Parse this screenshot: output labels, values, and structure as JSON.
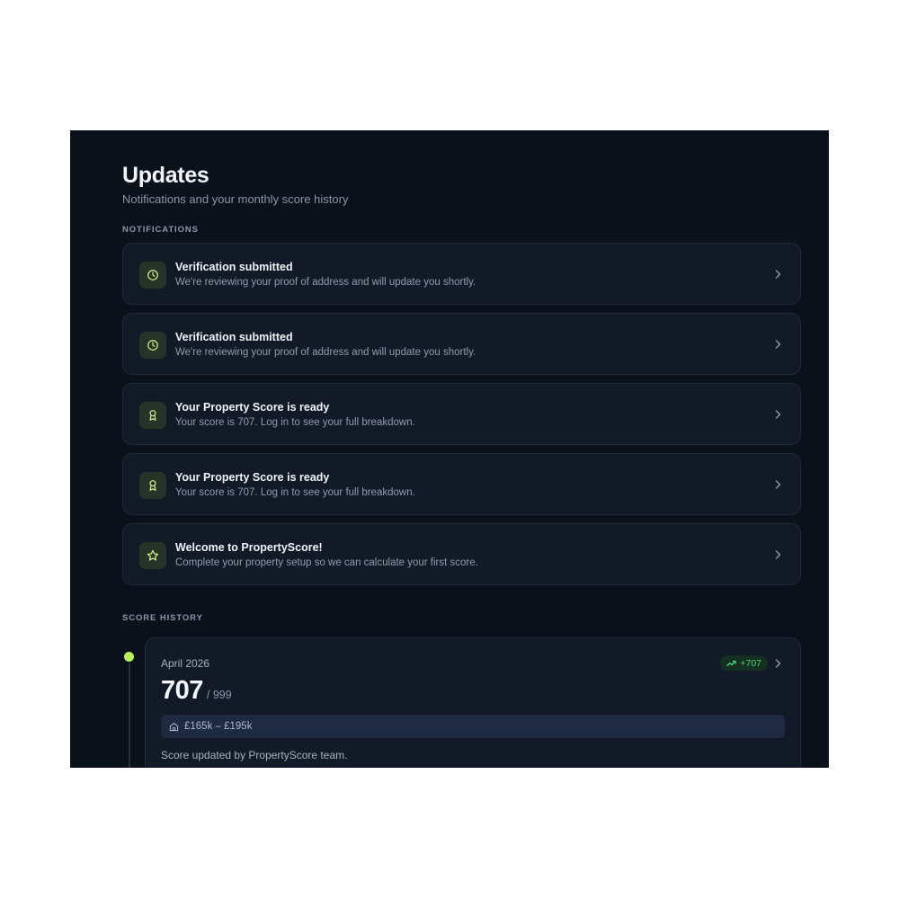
{
  "header": {
    "title": "Updates",
    "subtitle": "Notifications and your monthly score history"
  },
  "notifications": {
    "section_label": "NOTIFICATIONS",
    "items": [
      {
        "icon": "clock-icon",
        "title": "Verification submitted",
        "body": "We're reviewing your proof of address and will update you shortly."
      },
      {
        "icon": "clock-icon",
        "title": "Verification submitted",
        "body": "We're reviewing your proof of address and will update you shortly."
      },
      {
        "icon": "award-icon",
        "title": "Your Property Score is ready",
        "body": "Your score is 707. Log in to see your full breakdown."
      },
      {
        "icon": "award-icon",
        "title": "Your Property Score is ready",
        "body": "Your score is 707. Log in to see your full breakdown."
      },
      {
        "icon": "star-icon",
        "title": "Welcome to PropertyScore!",
        "body": "Complete your property setup so we can calculate your first score."
      }
    ]
  },
  "score_history": {
    "section_label": "SCORE HISTORY",
    "entries": [
      {
        "month": "April 2026",
        "change": "+707",
        "score": "707",
        "max": "/ 999",
        "value_range": "£165k – £195k",
        "note": "Score updated by PropertyScore team."
      }
    ]
  },
  "colors": {
    "background": "#0b111b",
    "card": "#121a28",
    "accent": "#b6ef5a",
    "positive": "#4fd37c"
  }
}
